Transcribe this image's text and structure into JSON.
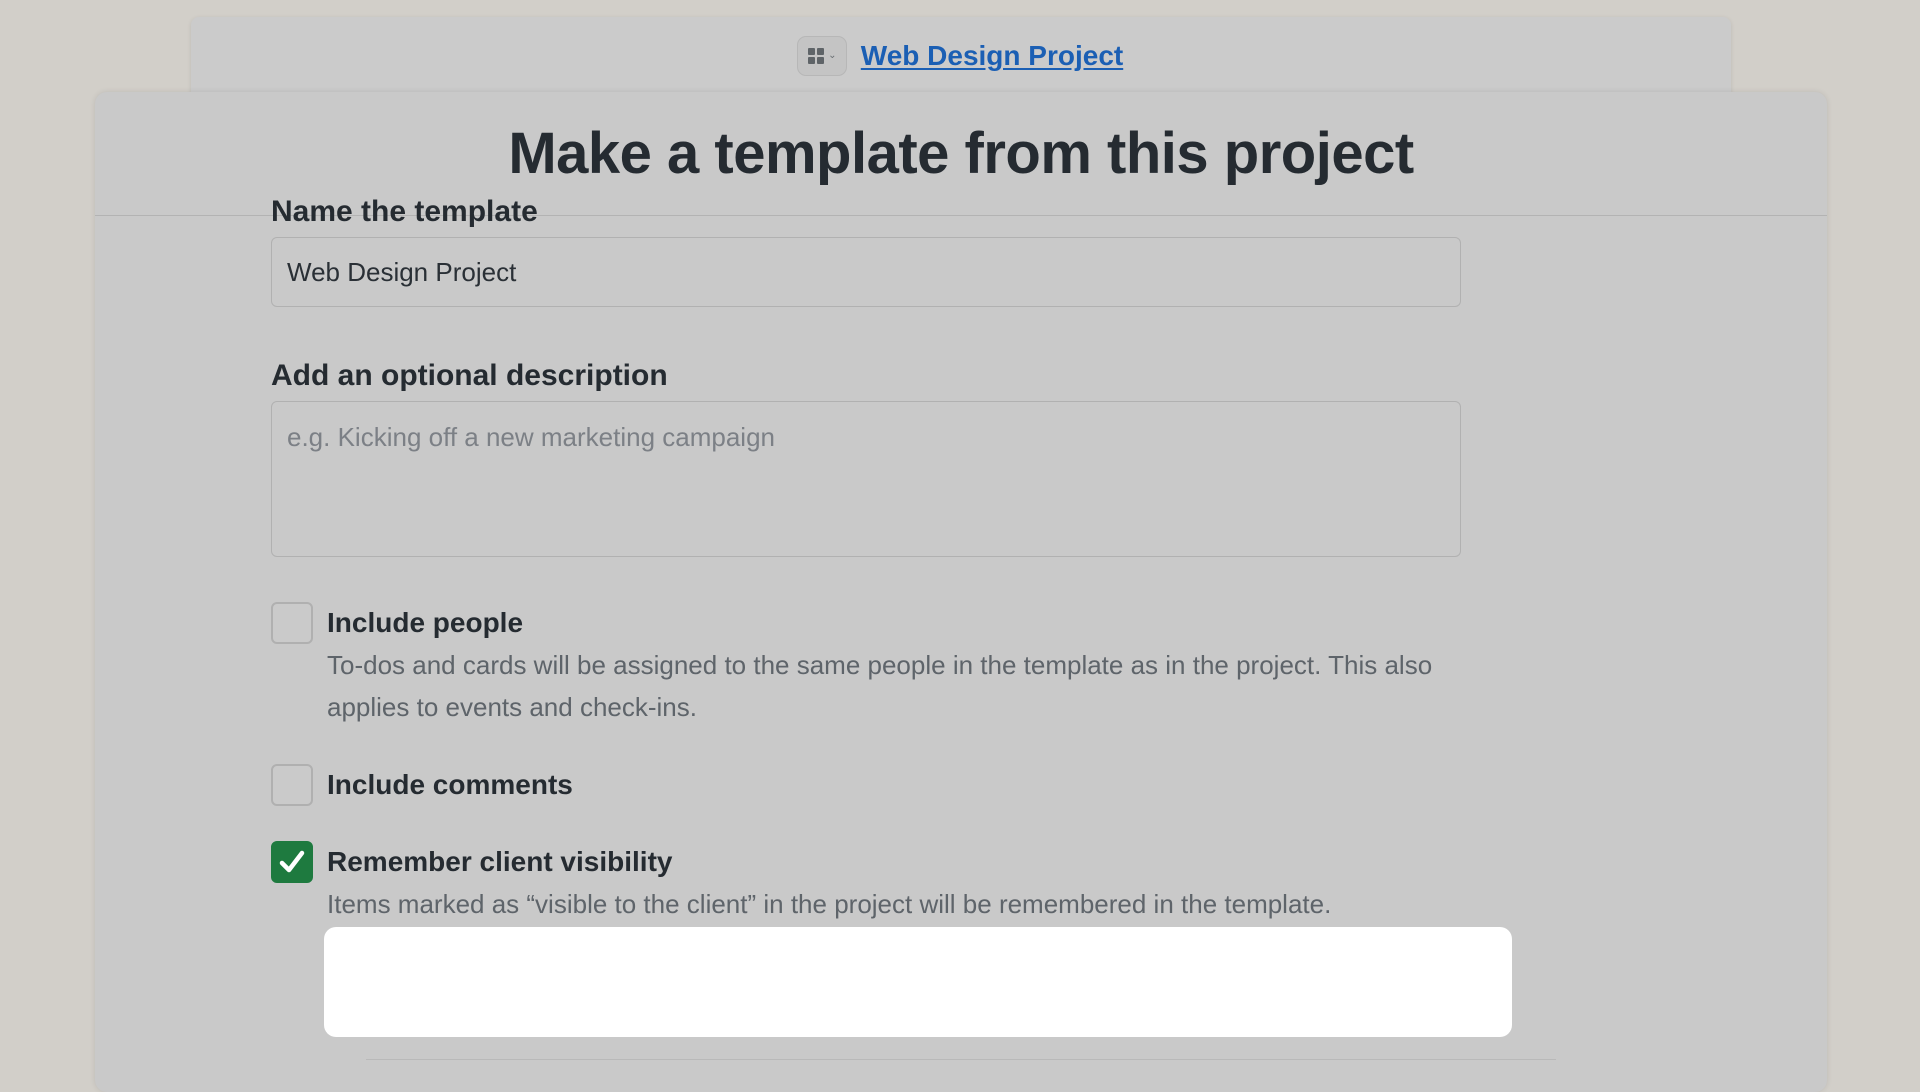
{
  "breadcrumb": {
    "switcher_icon": "grid-icon",
    "project_link": "Web Design Project"
  },
  "dialog": {
    "title": "Make a template from this project"
  },
  "form": {
    "name_label": "Name the template",
    "name_value": "Web Design Project",
    "description_label": "Add an optional description",
    "description_placeholder": "e.g. Kicking off a new marketing campaign",
    "options": [
      {
        "label": "Include people",
        "description": "To-dos and cards will be assigned to the same people in the template as in the project. This also applies to events and check-ins.",
        "checked": false
      },
      {
        "label": "Include comments",
        "description": "",
        "checked": false
      },
      {
        "label": "Remember client visibility",
        "description": "Items marked as “visible to the client” in the project will be remembered in the template.",
        "checked": true
      }
    ]
  },
  "colors": {
    "link": "#1b5fb4",
    "check_green": "#1e7a3f",
    "highlight_bg": "#ffffff"
  }
}
